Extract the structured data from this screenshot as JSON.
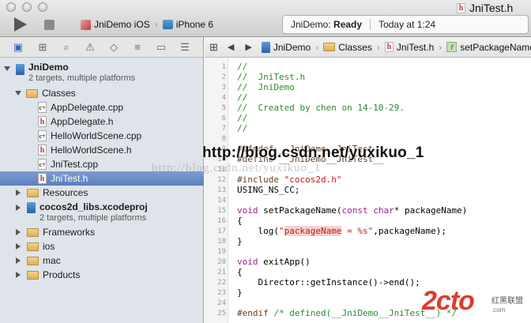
{
  "window": {
    "title": "JniTest.h",
    "scheme_project": "JniDemo iOS",
    "scheme_device": "iPhone 6",
    "status_project": "JniDemo:",
    "status_state": "Ready",
    "status_time": "Today at 1:24"
  },
  "jump_bar": {
    "crumbs": [
      "JniDemo",
      "Classes",
      "JniTest.h",
      "setPackageName"
    ]
  },
  "navigator": {
    "project": {
      "name": "JniDemo",
      "subtitle": "2 targets, multiple platforms"
    },
    "items": [
      {
        "label": "Classes"
      },
      {
        "label": "AppDelegate.cpp"
      },
      {
        "label": "AppDelegate.h"
      },
      {
        "label": "HelloWorldScene.cpp"
      },
      {
        "label": "HelloWorldScene.h"
      },
      {
        "label": "JniTest.cpp"
      },
      {
        "label": "JniTest.h"
      },
      {
        "label": "Resources"
      },
      {
        "label": "cocos2d_libs.xcodeproj",
        "subtitle": "2 targets, multiple platforms"
      },
      {
        "label": "Frameworks"
      },
      {
        "label": "ios"
      },
      {
        "label": "mac"
      },
      {
        "label": "Products"
      }
    ]
  },
  "editor": {
    "line_numbers": [
      "1",
      "2",
      "3",
      "4",
      "5",
      "6",
      "7",
      "8",
      "9",
      "10",
      "11",
      "12",
      "13",
      "14",
      "15",
      "16",
      "17",
      "18",
      "19",
      "20",
      "21",
      "22",
      "23",
      "24",
      "25"
    ],
    "lines": {
      "l1": "//",
      "l2": "//  JniTest.h",
      "l3": "//  JniDemo",
      "l4": "//",
      "l5": "//  Created by chen on 14-10-29.",
      "l6": "//",
      "l7": "//",
      "l9a": "#ifndef __JniDemo__JniTest",
      "l10": "#define __JniDemo__JniTest__",
      "l12_kw": "#include ",
      "l12_str": "\"cocos2d.h\"",
      "l13": "USING_NS_CC;",
      "l15_kw": "void",
      "l15_a": " setPackageName(",
      "l15_kw2": "const char",
      "l15_b": "* packageName)",
      "l16": "{",
      "l17_a": "    log(",
      "l17_q": "\"",
      "l17_hl": "packageName",
      "l17_str": " = %s\"",
      "l17_b": ",packageName);",
      "l18": "}",
      "l20_kw": "void",
      "l20_a": " exitApp()",
      "l21": "{",
      "l22": "    Director::getInstance()->end();",
      "l23": "}",
      "l25_kw": "#endif ",
      "l25_c": "/* defined(__JniDemo__JniTest__) */"
    }
  },
  "watermark": {
    "main": "http://blog.csdn.net/yuxikuo_1",
    "ghost": "http://blog.csdn.net/yuxikuo_1",
    "logo": "2cto",
    "logo_sub": "红黑联盟",
    "logo_url": ".com"
  }
}
